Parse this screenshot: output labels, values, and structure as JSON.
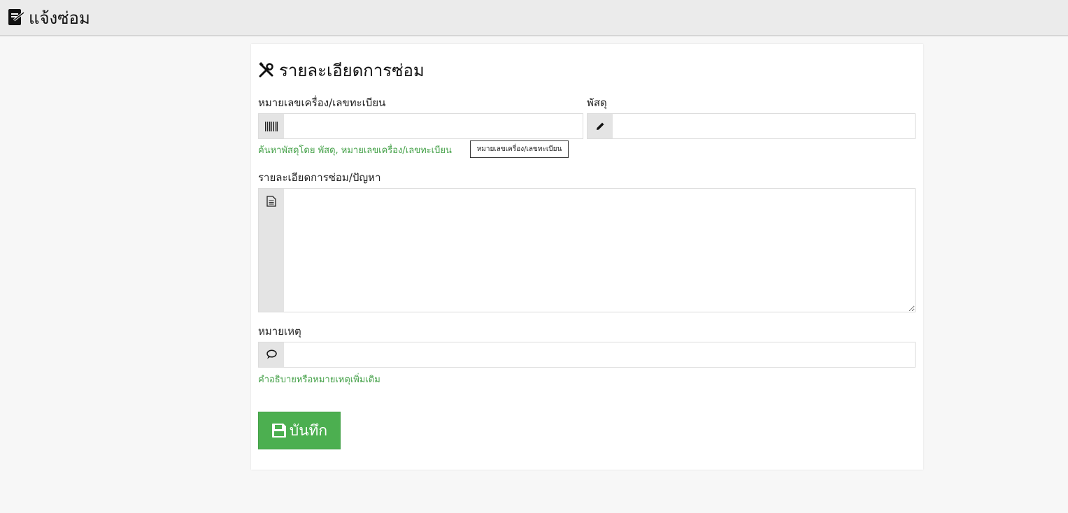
{
  "app": {
    "title": "แจ้งซ่อม",
    "logo_icon": "repair-document-icon"
  },
  "form": {
    "heading": "รายละเอียดการซ่อม",
    "heading_icon": "tools-icon",
    "serial": {
      "label": "หมายเลขเครื่อง/เลขทะเบียน",
      "value": "",
      "icon": "barcode-icon",
      "help": "ค้นหาพัสดุโดย พัสดุ, หมายเลขเครื่อง/เลขทะเบียน",
      "tooltip": "หมายเลขเครื่อง/เลขทะเบียน"
    },
    "item": {
      "label": "พัสดุ",
      "value": "",
      "icon": "pencil-icon"
    },
    "detail": {
      "label": "รายละเอียดการซ่อม/ปัญหา",
      "value": "",
      "icon": "document-icon"
    },
    "note": {
      "label": "หมายเหตุ",
      "value": "",
      "icon": "comment-icon",
      "help": "คำอธิบายหรือหมายเหตุเพิ่มเติม"
    },
    "save_label": "บันทึก",
    "save_icon": "floppy-disk-icon"
  },
  "colors": {
    "accent": "#4caf50",
    "help_text": "#43a047",
    "topbar": "#ebebeb"
  }
}
